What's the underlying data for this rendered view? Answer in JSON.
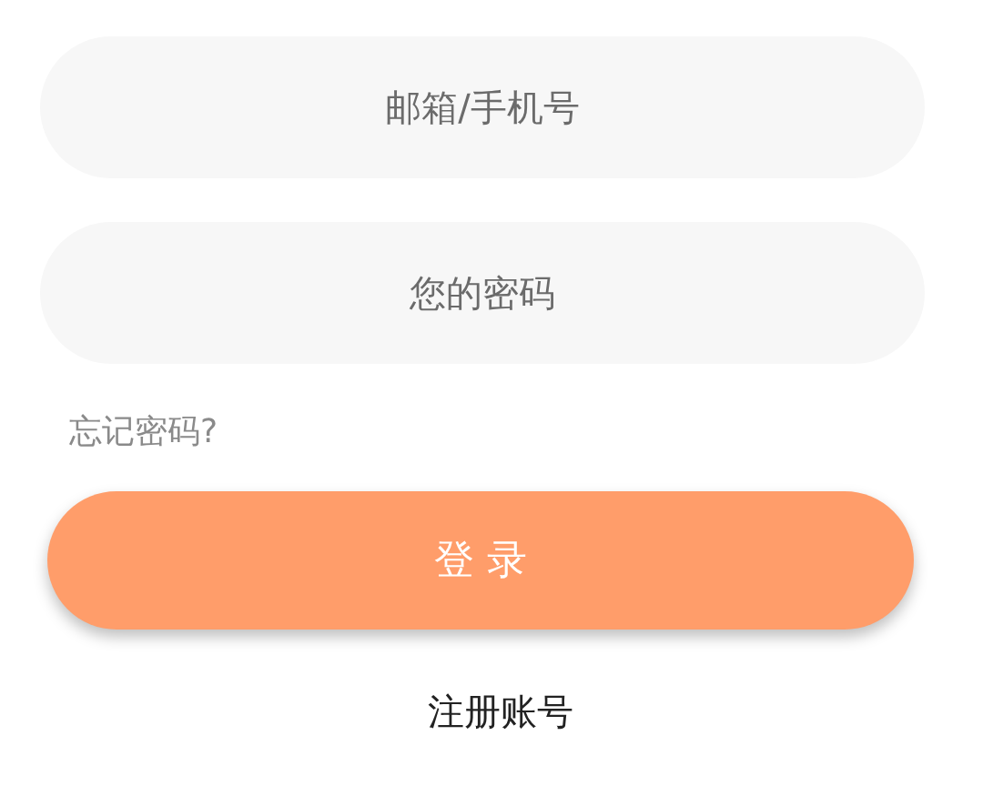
{
  "fields": [
    {
      "placeholder": "邮箱/手机号"
    },
    {
      "placeholder": "您的密码"
    }
  ],
  "forgot_link": "忘记密码?",
  "login_button": "登 录",
  "register_link": "注册账号"
}
